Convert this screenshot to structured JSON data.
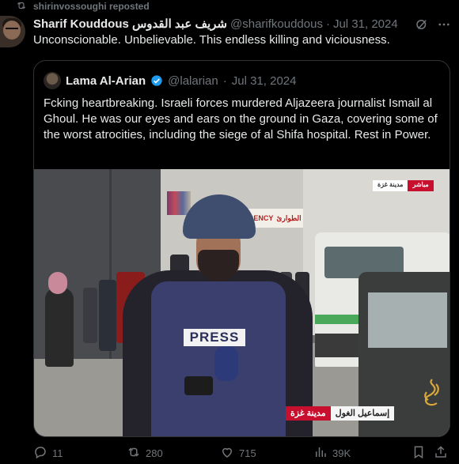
{
  "repost": {
    "label": "shirinvossoughi reposted"
  },
  "tweet": {
    "author_name": "Sharif Kouddous شريف عبد القدوس",
    "handle": "@sharifkouddous",
    "separator": "·",
    "date": "Jul 31, 2024",
    "text": "Unconscionable. Unbelievable. This endless killing and viciousness."
  },
  "quote": {
    "author_name": "Lama Al-Arian",
    "handle": "@lalarian",
    "separator": "·",
    "date": "Jul 31, 2024",
    "text": "Fcking heartbreaking. Israeli forces murdered Aljazeera journalist Ismail al Ghoul. He was our eyes and ears on the ground in Gaza, covering some of the worst atrocities, including the siege of al Shifa hospital. Rest in Power.",
    "media": {
      "vest_label": "PRESS",
      "sign_text": "GENCY",
      "sign_arabic": "الطوارئ",
      "badge_city": "مدينة غزة",
      "badge_live": "مباشر",
      "lower_city": "مدينة غزة",
      "lower_reporter": "إسماعيل الغول"
    }
  },
  "actions": {
    "replies": "11",
    "reposts": "280",
    "likes": "715",
    "views": "39K"
  },
  "colors": {
    "background": "#000000",
    "text": "#e7e9ea",
    "muted": "#71767b",
    "border": "#2f3336",
    "verified": "#1d9bf0",
    "aljazeera_red": "#c8102e"
  },
  "icons": [
    "repost-icon",
    "grok-icon",
    "more-icon",
    "verified-icon",
    "reply-icon",
    "retweet-icon",
    "like-icon",
    "views-icon",
    "bookmark-icon",
    "share-icon",
    "aljazeera-logo"
  ]
}
